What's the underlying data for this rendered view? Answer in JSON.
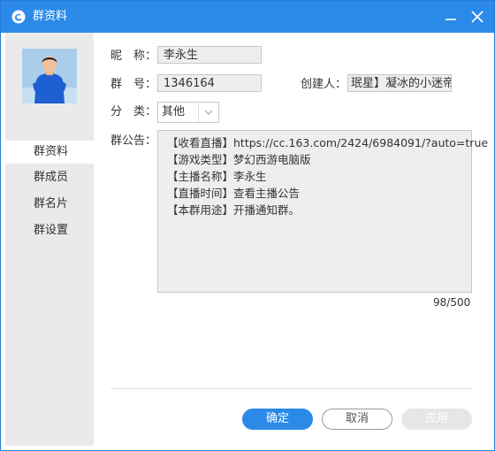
{
  "window": {
    "title": "群资料"
  },
  "sidebar": {
    "items": [
      {
        "label": "群资料"
      },
      {
        "label": "群成员"
      },
      {
        "label": "群名片"
      },
      {
        "label": "群设置"
      }
    ]
  },
  "form": {
    "nickname_label": "昵　称：",
    "nickname_value": "李永生",
    "group_id_label": "群　号：",
    "group_id_value": "1346164",
    "creator_label": "创建人：",
    "creator_value": "珉星】凝冰的小迷帝",
    "category_label": "分　类：",
    "category_value": "其他",
    "notice_label": "群公告：",
    "notice_lines": [
      "【收看直播】https://cc.163.com/2424/6984091/?auto=true",
      "【游戏类型】梦幻西游电脑版",
      "【主播名称】李永生",
      "【直播时间】查看主播公告",
      "【本群用途】开播通知群。"
    ],
    "notice_counter": "98/500"
  },
  "buttons": {
    "ok": "确定",
    "cancel": "取消",
    "apply": "应用"
  },
  "colors": {
    "accent": "#2b8ae8",
    "sidebar_bg": "#eaeaea",
    "field_bg": "#eeeeee"
  }
}
